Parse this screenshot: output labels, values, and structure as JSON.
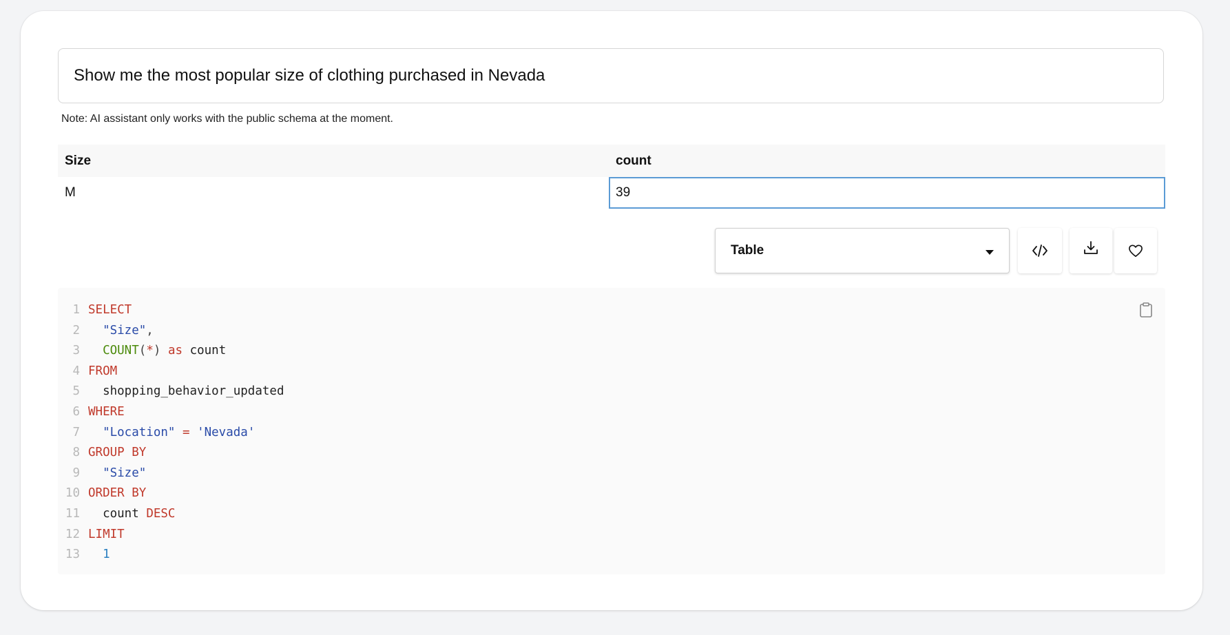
{
  "query": {
    "text": "Show me the most popular size of clothing purchased in Nevada"
  },
  "note": "Note: AI assistant only works with the public schema at the moment.",
  "table": {
    "columns": [
      "Size",
      "count"
    ],
    "rows": [
      [
        "M",
        "39"
      ]
    ]
  },
  "view_select": {
    "value": "Table"
  },
  "toolbar": {
    "icons": [
      "code-icon",
      "download-icon",
      "heart-icon"
    ]
  },
  "code": {
    "line_numbers": [
      "1",
      "2",
      "3",
      "4",
      "5",
      "6",
      "7",
      "8",
      "9",
      "10",
      "11",
      "12",
      "13"
    ],
    "l1_kw": "SELECT",
    "l2_str": "\"Size\"",
    "l2_p": ",",
    "l3_fn": "COUNT",
    "l3_p1": "(",
    "l3_star": "*",
    "l3_p2": ")",
    "l3_kw": "as",
    "l3_id": "count",
    "l4_kw": "FROM",
    "l5_id": "shopping_behavior_updated",
    "l6_kw": "WHERE",
    "l7_str1": "\"Location\"",
    "l7_op": "=",
    "l7_str2": "'Nevada'",
    "l8_kw": "GROUP BY",
    "l9_str": "\"Size\"",
    "l10_kw": "ORDER BY",
    "l11_id": "count",
    "l11_kw": "DESC",
    "l12_kw": "LIMIT",
    "l13_num": "1"
  },
  "colors": {
    "keyword": "#c0392b",
    "string": "#2a4ba8",
    "function": "#4b8a0b",
    "number": "#2a7fc0",
    "selected_cell_border": "#5b9bd5"
  }
}
